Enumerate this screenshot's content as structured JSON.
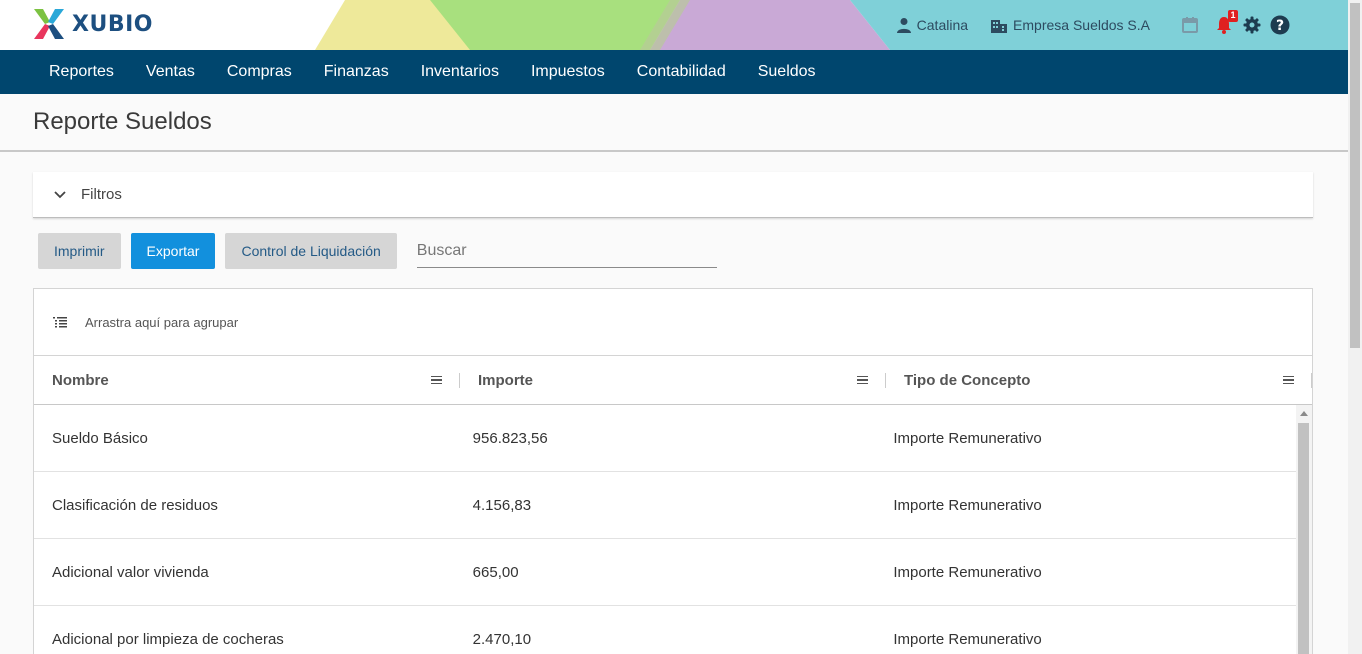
{
  "app": {
    "logo_text": "XUBIO",
    "colors": {
      "nav_bg": "#00466e",
      "accent": "#1290dd",
      "brand": "#1d4f80",
      "badge": "#e02020"
    }
  },
  "header": {
    "user_name": "Catalina",
    "company": "Empresa Sueldos S.A",
    "notification_count": "1",
    "icons": [
      "user-icon",
      "building-icon",
      "calendar-icon",
      "bell-icon",
      "gear-icon",
      "help-icon"
    ]
  },
  "nav": {
    "items": [
      "Reportes",
      "Ventas",
      "Compras",
      "Finanzas",
      "Inventarios",
      "Impuestos",
      "Contabilidad",
      "Sueldos"
    ]
  },
  "page": {
    "title": "Reporte Sueldos"
  },
  "filters": {
    "label": "Filtros"
  },
  "toolbar": {
    "print_label": "Imprimir",
    "export_label": "Exportar",
    "control_label": "Control de Liquidación",
    "search_placeholder": "Buscar",
    "search_value": ""
  },
  "grid": {
    "group_panel_text": "Arrastra aquí para agrupar",
    "columns": [
      "Nombre",
      "Importe",
      "Tipo de Concepto"
    ],
    "rows": [
      {
        "nombre": "Sueldo Básico",
        "importe": "956.823,56",
        "tipo": "Importe Remunerativo"
      },
      {
        "nombre": "Clasificación de residuos",
        "importe": "4.156,83",
        "tipo": "Importe Remunerativo"
      },
      {
        "nombre": "Adicional valor vivienda",
        "importe": "665,00",
        "tipo": "Importe Remunerativo"
      },
      {
        "nombre": "Adicional por limpieza de cocheras",
        "importe": "2.470,10",
        "tipo": "Importe Remunerativo"
      }
    ]
  }
}
